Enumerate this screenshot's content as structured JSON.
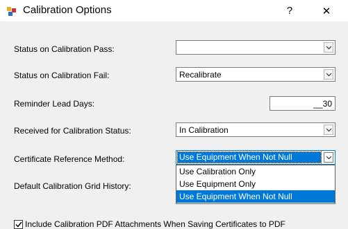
{
  "window": {
    "title": "Calibration Options",
    "help_label": "?",
    "close_label": "✕"
  },
  "fields": {
    "status_pass": {
      "label": "Status on Calibration Pass:",
      "value": ""
    },
    "status_fail": {
      "label": "Status on Calibration Fail:",
      "value": "Recalibrate"
    },
    "reminder": {
      "label": "Reminder Lead Days:",
      "value": "__30"
    },
    "received_status": {
      "label": "Received for Calibration Status:",
      "value": "In Calibration"
    },
    "cert_ref": {
      "label": "Certificate Reference Method:",
      "value": "Use Equipment When Not Null"
    },
    "grid_history": {
      "label": "Default Calibration Grid History:"
    }
  },
  "dropdown": {
    "options": [
      "Use Calibration Only",
      "Use Equipment Only",
      "Use Equipment When Not Null"
    ],
    "selected_index": 2
  },
  "include_pdf": {
    "label": "Include Calibration PDF Attachments When Saving Certificates to PDF",
    "checked": true
  },
  "colors": {
    "accent": "#0078d7",
    "background": "#f0f0f0"
  }
}
